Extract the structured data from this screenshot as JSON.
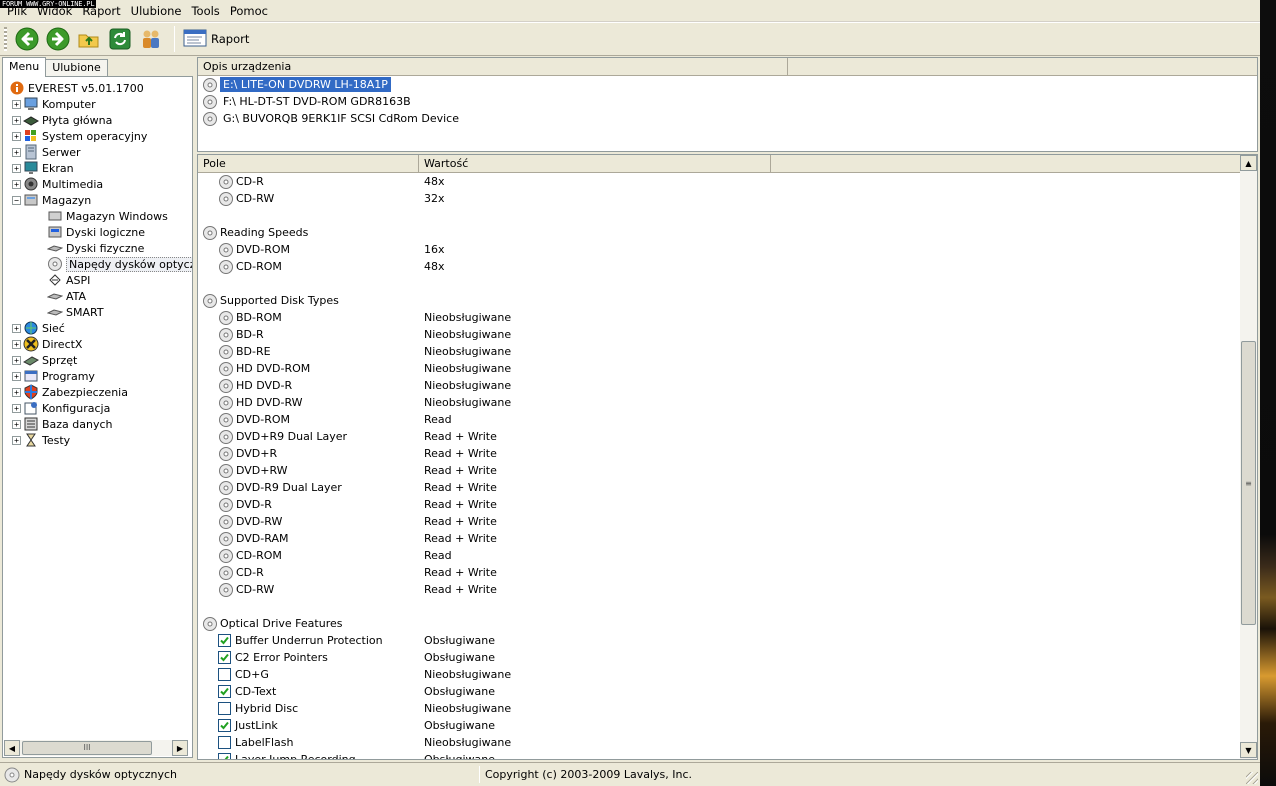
{
  "watermark": "FORUM WWW.GRY-ONLINE.PL",
  "menubar": [
    "Plik",
    "Widok",
    "Raport",
    "Ulubione",
    "Tools",
    "Pomoc"
  ],
  "toolbar": {
    "report_label": "Raport"
  },
  "tabs": {
    "menu": "Menu",
    "favorites": "Ulubione"
  },
  "tree": {
    "root": "EVEREST v5.01.1700",
    "items": [
      {
        "label": "Komputer",
        "icon": "computer-icon"
      },
      {
        "label": "Płyta główna",
        "icon": "motherboard-icon"
      },
      {
        "label": "System operacyjny",
        "icon": "windows-icon"
      },
      {
        "label": "Serwer",
        "icon": "server-icon"
      },
      {
        "label": "Ekran",
        "icon": "monitor-icon"
      },
      {
        "label": "Multimedia",
        "icon": "speaker-icon"
      },
      {
        "label": "Magazyn",
        "icon": "storage-icon"
      }
    ],
    "storage_children": [
      "Magazyn Windows",
      "Dyski logiczne",
      "Dyski fizyczne",
      "Napędy dysków optycznych",
      "ASPI",
      "ATA",
      "SMART"
    ],
    "more_items": [
      {
        "label": "Sieć",
        "icon": "network-icon"
      },
      {
        "label": "DirectX",
        "icon": "directx-icon"
      },
      {
        "label": "Sprzęt",
        "icon": "hardware-icon"
      },
      {
        "label": "Programy",
        "icon": "programs-icon"
      },
      {
        "label": "Zabezpieczenia",
        "icon": "security-icon"
      },
      {
        "label": "Konfiguracja",
        "icon": "config-icon"
      },
      {
        "label": "Baza danych",
        "icon": "database-icon"
      },
      {
        "label": "Testy",
        "icon": "hourglass-icon"
      }
    ],
    "hscroll_glyph": "III"
  },
  "devices": {
    "header": "Opis urządzenia",
    "rows": [
      "E:\\  LITE-ON DVDRW LH-18A1P",
      "F:\\  HL-DT-ST DVD-ROM GDR8163B",
      "G:\\  BUVORQB 9ERK1IF SCSI CdRom Device"
    ]
  },
  "details": {
    "header_field": "Pole",
    "header_value": "Wartość",
    "rows": [
      {
        "type": "item",
        "field": "CD-R",
        "value": "48x"
      },
      {
        "type": "item",
        "field": "CD-RW",
        "value": "32x"
      },
      {
        "type": "blank"
      },
      {
        "type": "group",
        "field": "Reading Speeds"
      },
      {
        "type": "item",
        "field": "DVD-ROM",
        "value": "16x"
      },
      {
        "type": "item",
        "field": "CD-ROM",
        "value": "48x"
      },
      {
        "type": "blank"
      },
      {
        "type": "group",
        "field": "Supported Disk Types"
      },
      {
        "type": "item",
        "field": "BD-ROM",
        "value": "Nieobsługiwane"
      },
      {
        "type": "item",
        "field": "BD-R",
        "value": "Nieobsługiwane"
      },
      {
        "type": "item",
        "field": "BD-RE",
        "value": "Nieobsługiwane"
      },
      {
        "type": "item",
        "field": "HD DVD-ROM",
        "value": "Nieobsługiwane"
      },
      {
        "type": "item",
        "field": "HD DVD-R",
        "value": "Nieobsługiwane"
      },
      {
        "type": "item",
        "field": "HD DVD-RW",
        "value": "Nieobsługiwane"
      },
      {
        "type": "item",
        "field": "DVD-ROM",
        "value": "Read"
      },
      {
        "type": "item",
        "field": "DVD+R9 Dual Layer",
        "value": "Read + Write"
      },
      {
        "type": "item",
        "field": "DVD+R",
        "value": "Read + Write"
      },
      {
        "type": "item",
        "field": "DVD+RW",
        "value": "Read + Write"
      },
      {
        "type": "item",
        "field": "DVD-R9 Dual Layer",
        "value": "Read + Write"
      },
      {
        "type": "item",
        "field": "DVD-R",
        "value": "Read + Write"
      },
      {
        "type": "item",
        "field": "DVD-RW",
        "value": "Read + Write"
      },
      {
        "type": "item",
        "field": "DVD-RAM",
        "value": "Read + Write"
      },
      {
        "type": "item",
        "field": "CD-ROM",
        "value": "Read"
      },
      {
        "type": "item",
        "field": "CD-R",
        "value": "Read + Write"
      },
      {
        "type": "item",
        "field": "CD-RW",
        "value": "Read + Write"
      },
      {
        "type": "blank"
      },
      {
        "type": "group",
        "field": "Optical Drive Features"
      },
      {
        "type": "check",
        "checked": true,
        "field": "Buffer Underrun Protection",
        "value": "Obsługiwane"
      },
      {
        "type": "check",
        "checked": true,
        "field": "C2 Error Pointers",
        "value": "Obsługiwane"
      },
      {
        "type": "check",
        "checked": false,
        "field": "CD+G",
        "value": "Nieobsługiwane"
      },
      {
        "type": "check",
        "checked": true,
        "field": "CD-Text",
        "value": "Obsługiwane"
      },
      {
        "type": "check",
        "checked": false,
        "field": "Hybrid Disc",
        "value": "Nieobsługiwane"
      },
      {
        "type": "check",
        "checked": true,
        "field": "JustLink",
        "value": "Obsługiwane"
      },
      {
        "type": "check",
        "checked": false,
        "field": "LabelFlash",
        "value": "Nieobsługiwane"
      },
      {
        "type": "check",
        "checked": true,
        "field": "Layer Jump Recording",
        "value": "Obsługiwane"
      }
    ]
  },
  "status": {
    "left": "Napędy dysków optycznych",
    "right": "Copyright (c) 2003-2009 Lavalys, Inc."
  }
}
